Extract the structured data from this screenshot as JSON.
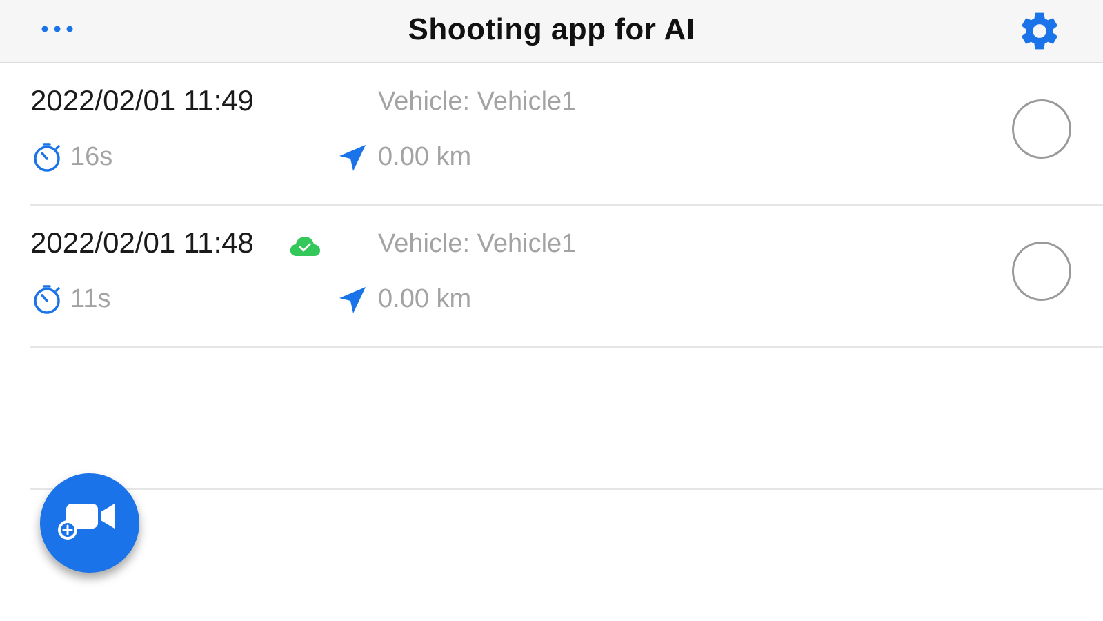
{
  "colors": {
    "accent": "#1a73e8",
    "cloud_synced": "#34c759",
    "navbar_bg": "#f6f6f6",
    "secondary_text": "#a3a3a3"
  },
  "navbar": {
    "title": "Shooting app for AI",
    "left_icon": "more-dots-icon",
    "right_icon": "gear-icon"
  },
  "recordings": [
    {
      "datetime": "2022/02/01 11:49",
      "synced": false,
      "vehicle": "Vehicle: Vehicle1",
      "duration": "16s",
      "distance": "0.00 km",
      "selected": false
    },
    {
      "datetime": "2022/02/01 11:48",
      "synced": true,
      "vehicle": "Vehicle: Vehicle1",
      "duration": "11s",
      "distance": "0.00 km",
      "selected": false
    }
  ],
  "fab": {
    "icon": "add-video-icon"
  }
}
